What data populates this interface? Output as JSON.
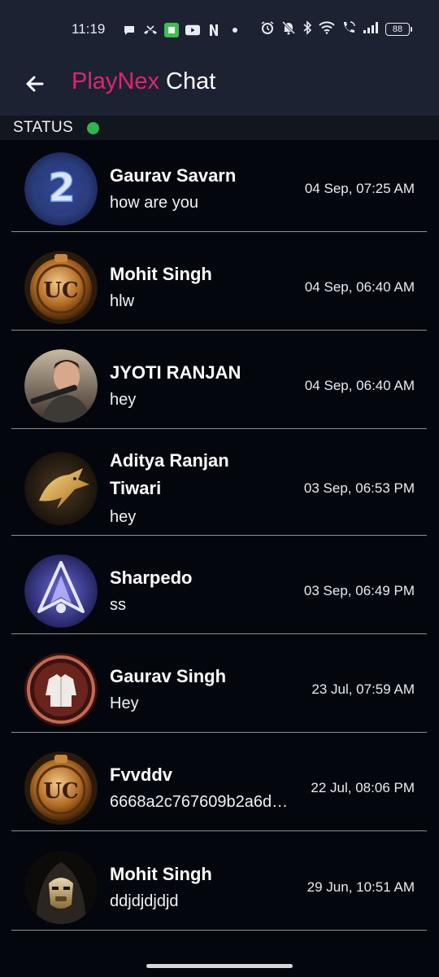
{
  "status_bar": {
    "time": "11:19",
    "battery": "88",
    "left_icons": [
      "chat-bubble-icon",
      "missed-call-icon",
      "green-app-icon",
      "youtube-icon",
      "netflix-icon",
      "dot-icon"
    ],
    "right_icons": [
      "alarm-icon",
      "bell-off-icon",
      "bluetooth-icon",
      "wifi-icon",
      "wifi-calling-icon",
      "signal-icon"
    ]
  },
  "app_bar": {
    "back_icon": "arrow-back-icon",
    "title_brand": "PlayNex",
    "title_rest": " Chat",
    "brand_color": "#e0246f"
  },
  "status_row": {
    "label": "STATUS",
    "indicator_color": "#2fb64b"
  },
  "chats": [
    {
      "name": "Gaurav Savarn",
      "message": "how are you",
      "time": "04 Sep, 07:25 AM",
      "avatar": "number-2-emblem-avatar"
    },
    {
      "name": "Mohit Singh",
      "message": "hlw",
      "time": "04 Sep, 06:40 AM",
      "avatar": "uc-coin-avatar"
    },
    {
      "name": "JYOTI RANJAN",
      "message": "hey",
      "time": "04 Sep, 06:40 AM",
      "avatar": "sniper-soldier-avatar"
    },
    {
      "name": "Aditya Ranjan Tiwari",
      "message": "hey",
      "time": "03 Sep, 06:53 PM",
      "avatar": "golden-dragon-avatar"
    },
    {
      "name": "Sharpedo",
      "message": "ss",
      "time": "03 Sep, 06:49 PM",
      "avatar": "wolf-emblem-avatar"
    },
    {
      "name": "Gaurav Singh",
      "message": "Hey",
      "time": "23 Jul, 07:59 AM",
      "avatar": "jacket-badge-avatar"
    },
    {
      "name": "Fvvddv",
      "message": "6668a2c767609b2a6d…",
      "time": "22 Jul, 08:06 PM",
      "avatar": "uc-coin-avatar"
    },
    {
      "name": "Mohit Singh",
      "message": "ddjdjdjdjd",
      "time": "29 Jun, 10:51 AM",
      "avatar": "masked-assassin-avatar"
    }
  ]
}
